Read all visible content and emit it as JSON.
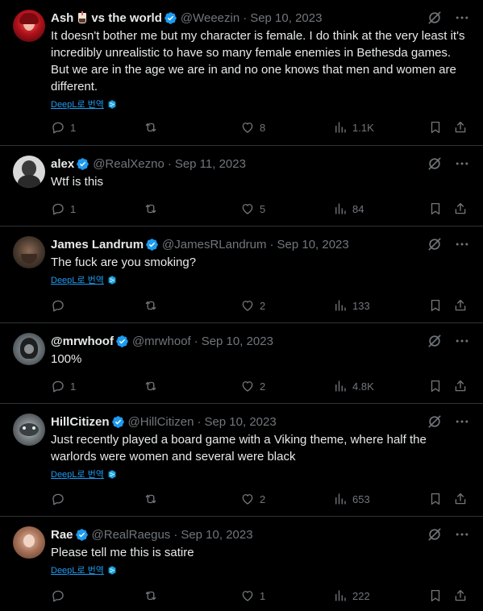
{
  "colors": {
    "background": "#000000",
    "text": "#e7e9ea",
    "muted": "#71767b",
    "link": "#1d9bf0",
    "verified": "#1d9bf0",
    "divider": "#2f3336"
  },
  "icons": [
    "verified-badge-icon",
    "grok-icon",
    "more-icon",
    "reply-icon",
    "retweet-icon",
    "like-icon",
    "views-icon",
    "bookmark-icon",
    "share-icon",
    "deepl-icon"
  ],
  "tweets": [
    {
      "display_name": "Ash",
      "name_suffix": "vs the world",
      "handle": "@Weeezin",
      "sep": "·",
      "date": "Sep 10, 2023",
      "text": "It doesn't bother me but my character is female. I do think at the very least it's incredibly unrealistic to have so many female enemies in Bethesda games. But we are in the age we are in and no one knows that men and women are different.",
      "translate": "DeepL로 번역",
      "replies": "1",
      "retweets": "",
      "likes": "8",
      "views": "1.1K"
    },
    {
      "display_name": "alex",
      "handle": "@RealXezno",
      "sep": "·",
      "date": "Sep 11, 2023",
      "text": "Wtf is this",
      "translate": "",
      "replies": "1",
      "retweets": "",
      "likes": "5",
      "views": "84"
    },
    {
      "display_name": "James Landrum",
      "handle": "@JamesRLandrum",
      "sep": "·",
      "date": "Sep 10, 2023",
      "text": "The fuck are you smoking?",
      "translate": "DeepL로 번역",
      "replies": "",
      "retweets": "",
      "likes": "2",
      "views": "133"
    },
    {
      "display_name": "@mrwhoof",
      "handle": "@mrwhoof",
      "sep": "·",
      "date": "Sep 10, 2023",
      "text": "100%",
      "translate": "",
      "replies": "1",
      "retweets": "",
      "likes": "2",
      "views": "4.8K"
    },
    {
      "display_name": "HillCitizen",
      "handle": "@HillCitizen",
      "sep": "·",
      "date": "Sep 10, 2023",
      "text": "Just recently played a board game with a Viking theme, where half the warlords were women and several were black",
      "translate": "DeepL로 번역",
      "replies": "",
      "retweets": "",
      "likes": "2",
      "views": "653"
    },
    {
      "display_name": "Rae",
      "handle": "@RealRaegus",
      "sep": "·",
      "date": "Sep 10, 2023",
      "text": "Please tell me this is satire",
      "translate": "DeepL로 번역",
      "replies": "",
      "retweets": "",
      "likes": "1",
      "views": "222"
    }
  ]
}
